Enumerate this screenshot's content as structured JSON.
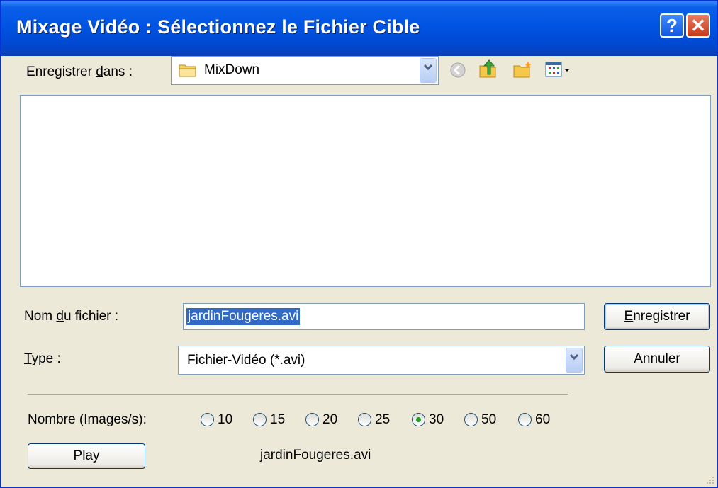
{
  "window": {
    "title": "Mixage Vidéo : Sélectionnez le Fichier Cible",
    "help_label": "?",
    "close_label": "✕"
  },
  "save_in": {
    "label_pre": "Enregistrer ",
    "label_accel": "d",
    "label_post": "ans :",
    "folder": "MixDown"
  },
  "filename": {
    "label_pre": "Nom ",
    "label_accel": "d",
    "label_post": "u fichier :",
    "value": "jardinFougeres.avi"
  },
  "type": {
    "label_accel": "T",
    "label_post": "ype :",
    "value": "Fichier-Vidéo (*.avi)"
  },
  "buttons": {
    "save_accel": "E",
    "save_post": "nregistrer",
    "cancel": "Annuler",
    "play": "Play"
  },
  "fps": {
    "label": "Nombre (Images/s):",
    "options": [
      "10",
      "15",
      "20",
      "25",
      "30",
      "50",
      "60"
    ],
    "selected": "30"
  },
  "status_filename": "jardinFougeres.avi",
  "colors": {
    "titlebar": "#0054e3",
    "selection": "#316ac5",
    "radio_dot": "#21a121"
  }
}
